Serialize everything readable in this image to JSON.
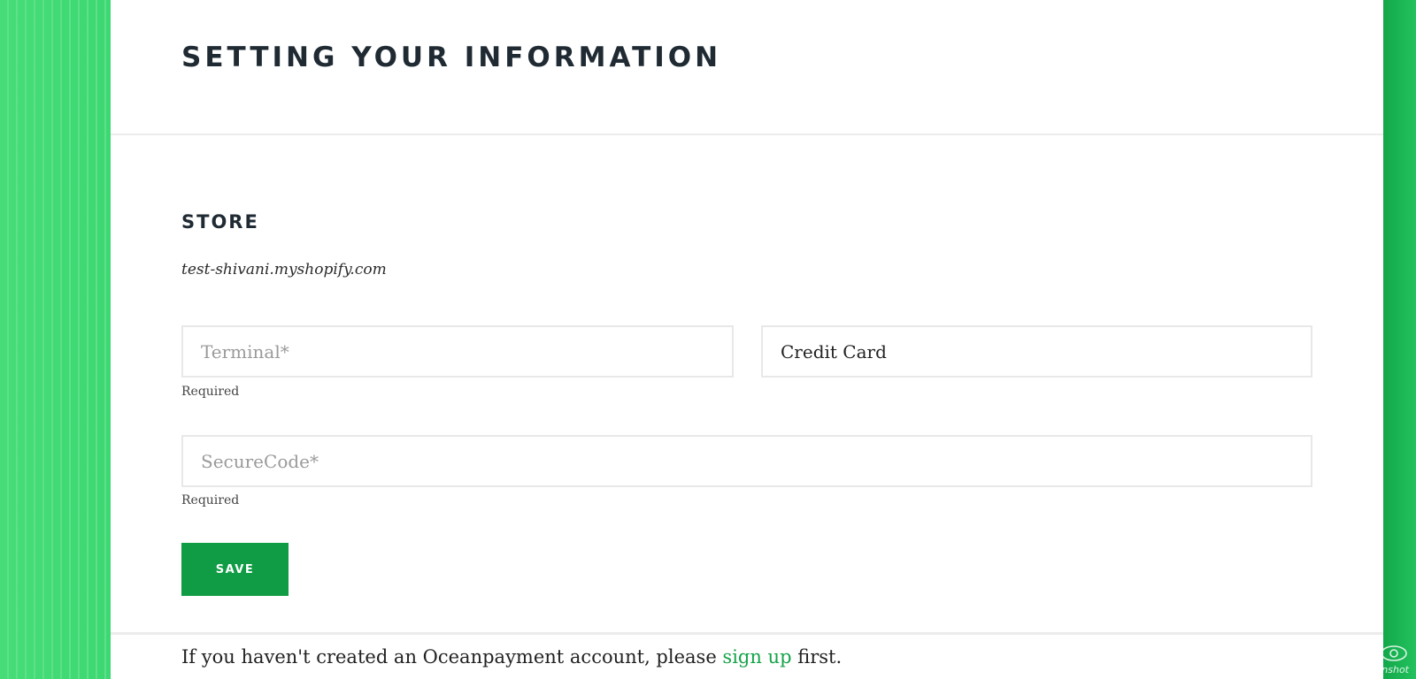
{
  "colors": {
    "accent": "#0f9c45",
    "link": "#16a34a",
    "background_green": "#35d46b",
    "title": "#1f2a33"
  },
  "header": {
    "title": "SETTING YOUR INFORMATION"
  },
  "store": {
    "section_title": "STORE",
    "domain": "test-shivani.myshopify.com"
  },
  "form": {
    "terminal": {
      "value": "",
      "placeholder": "Terminal*",
      "hint": "Required"
    },
    "payment_method": {
      "value": "Credit Card",
      "placeholder": ""
    },
    "secure_code": {
      "value": "",
      "placeholder": "SecureCode*",
      "hint": "Required"
    },
    "save_label": "SAVE"
  },
  "footer": {
    "text_before": "If you haven't created an Oceanpayment account, please ",
    "link_text": "sign up",
    "text_after": " first."
  },
  "watermark": {
    "text": "jetScreenshot",
    "icon": "eye-icon"
  }
}
